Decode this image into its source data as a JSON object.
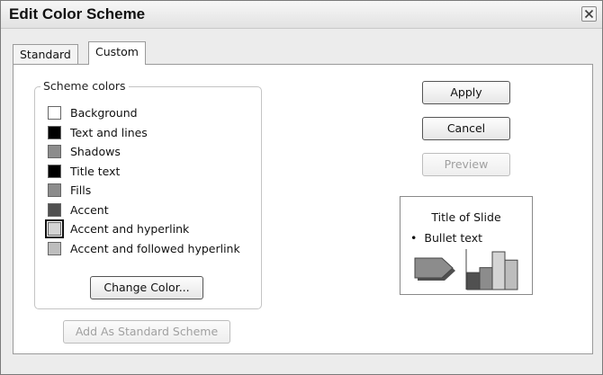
{
  "window": {
    "title": "Edit Color Scheme"
  },
  "tabs": [
    {
      "label": "Standard",
      "active": false
    },
    {
      "label": "Custom",
      "active": true
    }
  ],
  "scheme_colors": {
    "legend": "Scheme colors",
    "items": [
      {
        "label": "Background",
        "color": "#ffffff",
        "selected": false
      },
      {
        "label": "Text and lines",
        "color": "#000000",
        "selected": false
      },
      {
        "label": "Shadows",
        "color": "#8c8c8c",
        "selected": false
      },
      {
        "label": "Title text",
        "color": "#000000",
        "selected": false
      },
      {
        "label": "Fills",
        "color": "#8c8c8c",
        "selected": false
      },
      {
        "label": "Accent",
        "color": "#505050",
        "selected": false
      },
      {
        "label": "Accent and hyperlink",
        "color": "#d4d4d4",
        "selected": true
      },
      {
        "label": "Accent and followed hyperlink",
        "color": "#bdbdbd",
        "selected": false
      }
    ],
    "change_color_label": "Change Color..."
  },
  "add_standard_label": "Add As Standard Scheme",
  "buttons": {
    "apply": "Apply",
    "cancel": "Cancel",
    "preview": "Preview"
  },
  "preview": {
    "title": "Title of Slide",
    "bullet": "Bullet text",
    "bullet_marker": "•",
    "arrow_color": "#8c8c8c",
    "arrow_shadow_color": "#505050",
    "bar_colors": [
      "#505050",
      "#8c8c8c",
      "#d4d4d4",
      "#bdbdbd"
    ],
    "bar_values": [
      0.45,
      0.58,
      1.0,
      0.78
    ]
  }
}
